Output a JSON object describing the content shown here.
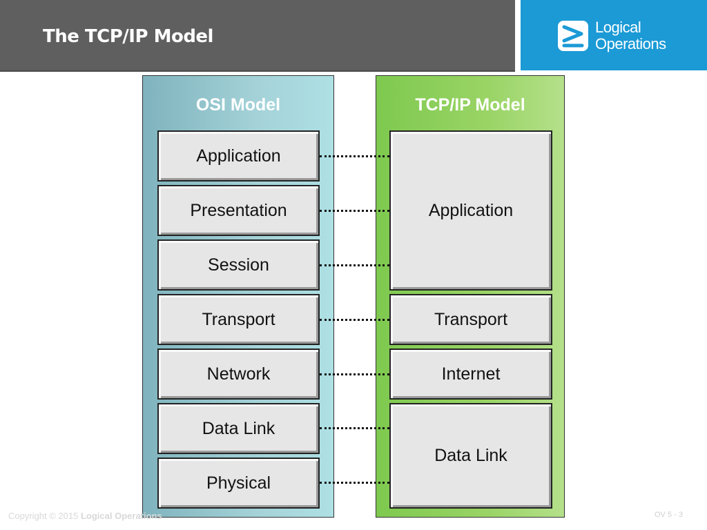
{
  "header": {
    "title": "The TCP/IP Model",
    "logo": {
      "icon": "logical-operations-logo-icon",
      "line1": "Logical",
      "line2": "Operations",
      "bg_color": "#1b9ad6"
    }
  },
  "osi_model": {
    "title": "OSI Model",
    "color": "#a4d2d8",
    "layers": [
      "Application",
      "Presentation",
      "Session",
      "Transport",
      "Network",
      "Data Link",
      "Physical"
    ]
  },
  "tcpip_model": {
    "title": "TCP/IP Model",
    "color": "#9ad466",
    "layers": [
      {
        "label": "Application",
        "maps_to": [
          "Application",
          "Presentation",
          "Session"
        ]
      },
      {
        "label": "Transport",
        "maps_to": [
          "Transport"
        ]
      },
      {
        "label": "Internet",
        "maps_to": [
          "Network"
        ]
      },
      {
        "label": "Data Link",
        "maps_to": [
          "Data Link",
          "Physical"
        ]
      }
    ]
  },
  "footer": {
    "copyright_prefix": "Copyright © 2015 ",
    "copyright_company": "Logical Operations",
    "page": "OV 5 - 3"
  }
}
